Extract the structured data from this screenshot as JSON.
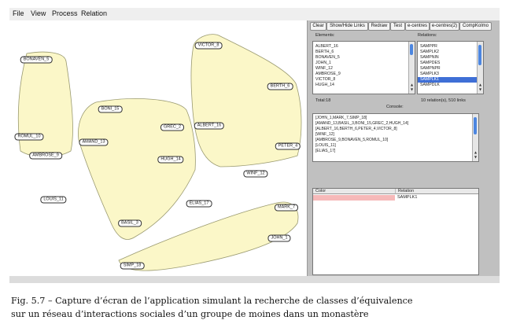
{
  "menu": [
    "File",
    "View",
    "Process",
    "Relation"
  ],
  "toolbar": [
    "Clear",
    "Show/Hide Links",
    "Redraw",
    "Test",
    "e-centres",
    "e-centres(2)",
    "CompKolmo"
  ],
  "elements_label": "Elements:",
  "relations_label": "Relations:",
  "elements": [
    "ALBERT_16",
    "BERTH_6",
    "BONAVEN_5",
    "JOHN_1",
    "WINF_12",
    "AMBROSE_9",
    "VICTOR_8",
    "HUGH_14"
  ],
  "relations": [
    "SAMPPR",
    "SAMPLK2",
    "SAMPNIN",
    "SAMPDES",
    "SAMPNPR",
    "SAMPLK3",
    "SAMPLK1",
    "SAMPDLK"
  ],
  "relations_selected": "SAMPLK1",
  "total": "Total:18",
  "relations_status": "10 relation(s), 510 links",
  "console_label": "Console:",
  "console_lines": [
    "[JOHN_1,MARK_7,SIMP_18]",
    "[AMAND_13,BASIL_3,BONI_15,GREC_2,HUGH_14]",
    "[ALBERT_16,BERTH_6,PETER_4,VICTOR_8]",
    "[WINF_12]",
    "[AMBROSE_9,BONAVEN_5,ROMUL_10]",
    "[LOUIS_11]",
    "[ELIAS_17]"
  ],
  "table": {
    "headers": [
      "Color",
      "Relation"
    ],
    "rows": [
      {
        "color": "#f6b9b9",
        "relation": "SAMPLK1"
      }
    ]
  },
  "graph": {
    "nodes": [
      "BONAVEN_5",
      "ROMUL_10",
      "AMBROSE_9",
      "BONI_15",
      "GREC_2",
      "AMAND_13",
      "HUGH_14",
      "BASIL_3",
      "LOUIS_11",
      "ELIAS_17",
      "VICTOR_8",
      "BERTH_6",
      "ALBERT_16",
      "PETER_4",
      "WINF_12",
      "MARK_7",
      "JOHN_1",
      "SIMP_18"
    ]
  },
  "caption": {
    "line1": "Fig. 5.7 – Capture d’écran de l’application simulant la recherche de classes d’équivalence",
    "line2": "sur un réseau d’interactions sociales d’un groupe de moines dans un monastère"
  },
  "colors": {
    "cluster_fill": "#fbf7c8",
    "cluster_stroke": "#9a9a70",
    "selection": "#3f6fd6",
    "scroll_thumb": "#4c86e0"
  }
}
